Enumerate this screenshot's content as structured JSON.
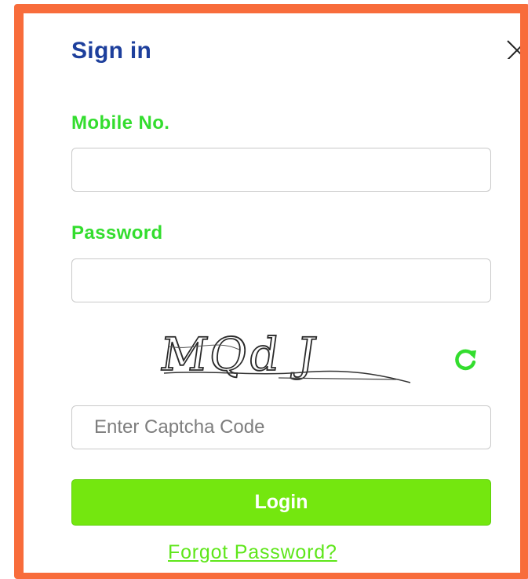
{
  "dialog": {
    "title": "Sign in",
    "close_icon": "close-icon"
  },
  "form": {
    "mobile": {
      "label": "Mobile No.",
      "value": "",
      "placeholder": ""
    },
    "password": {
      "label": "Password",
      "value": "",
      "placeholder": ""
    },
    "captcha": {
      "image_text": "MQd J",
      "refresh_icon": "refresh-icon",
      "input_value": "",
      "input_placeholder": "Enter Captcha Code"
    },
    "login_label": "Login",
    "forgot_password_label": "Forgot Password?"
  },
  "colors": {
    "frame_border": "#f86c3b",
    "title": "#1d3f9c",
    "label_green": "#33dd2e",
    "login_button": "#74e70f",
    "link": "#5ee61a"
  }
}
